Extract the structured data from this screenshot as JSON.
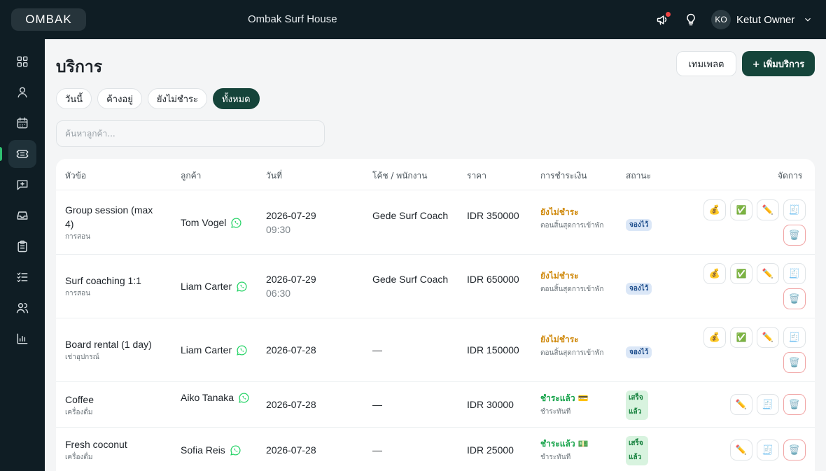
{
  "topbar": {
    "logo": "OMBAK",
    "brand": "Ombak Surf House",
    "user_initials": "KO",
    "user_name": "Ketut Owner"
  },
  "sidebar": {
    "items": [
      "dashboard",
      "profile",
      "calendar",
      "services",
      "add-note",
      "inbox",
      "clipboard",
      "checklist",
      "users",
      "reports"
    ],
    "active": "services"
  },
  "page": {
    "title": "บริการ",
    "template_button": "เทมเพลต",
    "add_button": "+ เพิ่มบริการ"
  },
  "filters": [
    {
      "label": "วันนี้",
      "active": false
    },
    {
      "label": "ค้างอยู่",
      "active": false
    },
    {
      "label": "ยังไม่ชำระ",
      "active": false
    },
    {
      "label": "ทั้งหมด",
      "active": true
    }
  ],
  "search": {
    "placeholder": "ค้นหาลูกค้า..."
  },
  "table": {
    "headers": {
      "title": "หัวข้อ",
      "customer": "ลูกค้า",
      "date": "วันที่",
      "coach": "โค้ช / พนักงาน",
      "price": "ราคา",
      "payment": "การชำระเงิน",
      "status": "สถานะ",
      "actions": "จัดการ"
    },
    "rows": [
      {
        "name": "Group session (max 4)",
        "category": "การสอน",
        "customer": "Tom Vogel",
        "date": "2026-07-29",
        "time": "09:30",
        "coach": "Gede Surf Coach",
        "price": "IDR 350000",
        "payment": "ยังไม่ชำระ",
        "payment_note": "ตอนสิ้นสุดการเข้าพัก",
        "status": "จองไว้"
      },
      {
        "name": "Surf coaching 1:1",
        "category": "การสอน",
        "customer": "Liam Carter",
        "date": "2026-07-29",
        "time": "06:30",
        "coach": "Gede Surf Coach",
        "price": "IDR 650000",
        "payment": "ยังไม่ชำระ",
        "payment_note": "ตอนสิ้นสุดการเข้าพัก",
        "status": "จองไว้"
      },
      {
        "name": "Board rental (1 day)",
        "category": "เช่าอุปกรณ์",
        "customer": "Liam Carter",
        "date": "2026-07-28",
        "time": "",
        "coach": "—",
        "price": "IDR 150000",
        "payment": "ยังไม่ชำระ",
        "payment_note": "ตอนสิ้นสุดการเข้าพัก",
        "status": "จองไว้"
      },
      {
        "name": "Coffee",
        "category": "เครื่องดื่ม",
        "customer": "Aiko Tanaka",
        "date": "2026-07-28",
        "time": "",
        "coach": "—",
        "price": "IDR 30000",
        "payment": "ชำระแล้ว 💳",
        "payment_note": "ชำระทันที",
        "status": "เสร็จแล้ว"
      },
      {
        "name": "Fresh coconut",
        "category": "เครื่องดื่ม",
        "customer": "Sofia Reis",
        "date": "2026-07-28",
        "time": "",
        "coach": "—",
        "price": "IDR 25000",
        "payment": "ชำระแล้ว 💵",
        "payment_note": "ชำระทันที",
        "status": "เสร็จแล้ว"
      }
    ]
  },
  "action_icons": {
    "charge": "💰",
    "complete": "✅",
    "edit": "✏️",
    "receipt": "🧾",
    "delete": "🗑️"
  },
  "colors": {
    "brand_dark": "#15443a",
    "unpaid": "#d08a0e",
    "paid": "#16a34a",
    "whatsapp": "#25d366"
  }
}
